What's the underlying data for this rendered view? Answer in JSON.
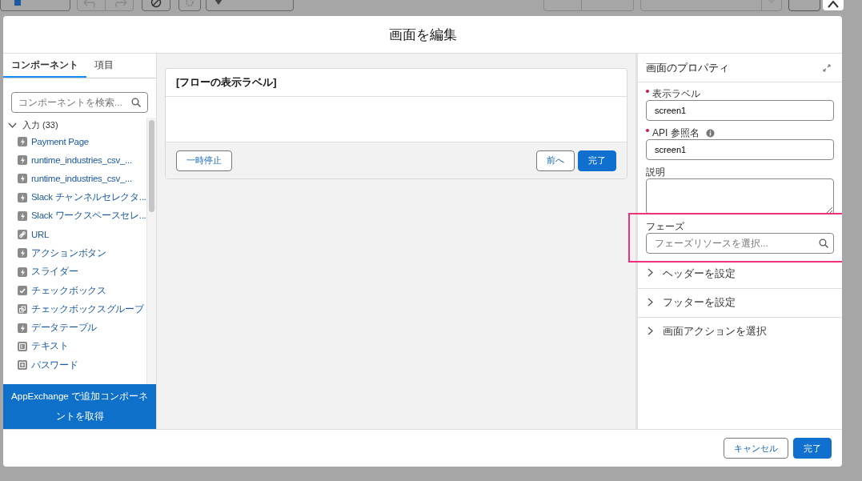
{
  "toolbar": {
    "left": [
      {
        "kind": "select"
      },
      {
        "kind": "undo"
      },
      {
        "kind": "redo"
      },
      {
        "kind": "ban"
      },
      {
        "kind": "gear"
      },
      {
        "kind": "dropdown"
      }
    ],
    "right": [
      {
        "kind": "group"
      },
      {
        "kind": "split"
      },
      {
        "kind": "save"
      }
    ]
  },
  "modal": {
    "title": "画面を編集",
    "tabs": [
      {
        "label": "コンポーネント",
        "selected": true
      },
      {
        "label": "項目",
        "selected": false
      }
    ],
    "search": {
      "placeholder": "コンポーネントを検索..."
    },
    "section": {
      "label": "入力 (33)",
      "expanded": true
    },
    "components": [
      {
        "label": "Payment Page",
        "kind": "bolt"
      },
      {
        "label": "runtime_industries_csv_...",
        "kind": "bolt"
      },
      {
        "label": "runtime_industries_csv_...",
        "kind": "bolt"
      },
      {
        "label": "Slack チャンネルセレクタ...",
        "kind": "bolt"
      },
      {
        "label": "Slack ワークスペースセレ...",
        "kind": "bolt"
      },
      {
        "label": "URL",
        "kind": "link"
      },
      {
        "label": "アクションボタン",
        "kind": "bolt"
      },
      {
        "label": "スライダー",
        "kind": "bolt"
      },
      {
        "label": "チェックボックス",
        "kind": "check"
      },
      {
        "label": "チェックボックスグループ",
        "kind": "group"
      },
      {
        "label": "データテーブル",
        "kind": "bolt"
      },
      {
        "label": "テキスト",
        "kind": "text"
      },
      {
        "label": "パスワード",
        "kind": "password"
      }
    ],
    "appexchange": "AppExchange で追加コンポーネントを取得",
    "canvas": {
      "title": "[フローの表示ラベル]",
      "buttons": [
        {
          "label": "一時停止",
          "kind": "neutral"
        },
        {
          "label": "前へ",
          "kind": "neutral"
        },
        {
          "label": "完了",
          "kind": "brand"
        }
      ]
    },
    "properties": {
      "title": "画面のプロパティ",
      "fields": [
        {
          "label": "表示ラベル",
          "required": true,
          "kind": "input",
          "value": "screen1"
        },
        {
          "label": "API 参照名",
          "required": true,
          "info": true,
          "kind": "input",
          "value": "screen1"
        },
        {
          "label": "説明",
          "kind": "textarea"
        },
        {
          "label": "フェーズ",
          "kind": "lookup",
          "placeholder": "フェーズリソースを選択...",
          "highlighted": true
        }
      ],
      "sections": [
        {
          "label": "ヘッダーを設定",
          "expanded": false
        },
        {
          "label": "フッターを設定",
          "expanded": false
        },
        {
          "label": "画面アクションを選択",
          "expanded": false
        }
      ]
    },
    "footer": [
      {
        "label": "キャンセル",
        "kind": "neutral"
      },
      {
        "label": "完了",
        "kind": "brand"
      }
    ]
  }
}
